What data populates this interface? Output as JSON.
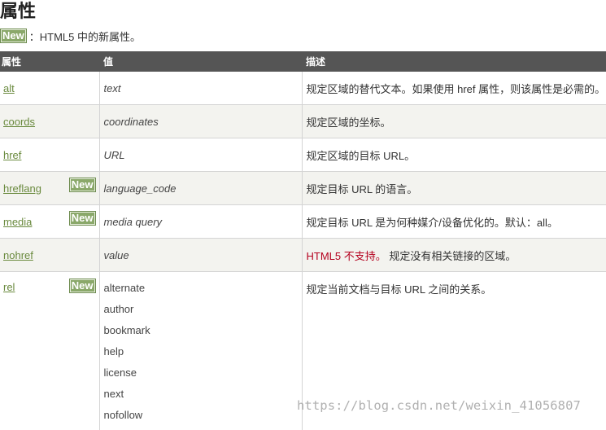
{
  "page": {
    "title": "属性",
    "legend_badge": "New",
    "legend_text": "：HTML5 中的新属性。"
  },
  "table": {
    "headers": [
      "属性",
      "值",
      "描述"
    ],
    "rows": [
      {
        "attr": "alt",
        "is_new": false,
        "value": "text",
        "desc": "规定区域的替代文本。如果使用 href 属性，则该属性是必需的。"
      },
      {
        "attr": "coords",
        "is_new": false,
        "value": "coordinates",
        "desc": "规定区域的坐标。"
      },
      {
        "attr": "href",
        "is_new": false,
        "value": "URL",
        "desc": "规定区域的目标 URL。"
      },
      {
        "attr": "hreflang",
        "is_new": true,
        "badge": "New",
        "value": "language_code",
        "desc": "规定目标 URL 的语言。"
      },
      {
        "attr": "media",
        "is_new": true,
        "badge": "New",
        "value": "media query",
        "desc": "规定目标 URL 是为何种媒介/设备优化的。默认：all。"
      },
      {
        "attr": "nohref",
        "is_new": false,
        "value": "value",
        "desc_warning": "HTML5 不支持。",
        "desc": " 规定没有相关链接的区域。"
      },
      {
        "attr": "rel",
        "is_new": true,
        "badge": "New",
        "values": [
          "alternate",
          "author",
          "bookmark",
          "help",
          "license",
          "next",
          "nofollow"
        ],
        "desc": "规定当前文档与目标 URL 之间的关系。"
      }
    ]
  },
  "watermark": "https://blog.csdn.net/weixin_41056807",
  "colors": {
    "header_bg": "#555555",
    "badge_bg": "#8aa86a",
    "link": "#6a8a3e",
    "warning": "#b4001e",
    "alt_row_bg": "#f3f3ef"
  }
}
